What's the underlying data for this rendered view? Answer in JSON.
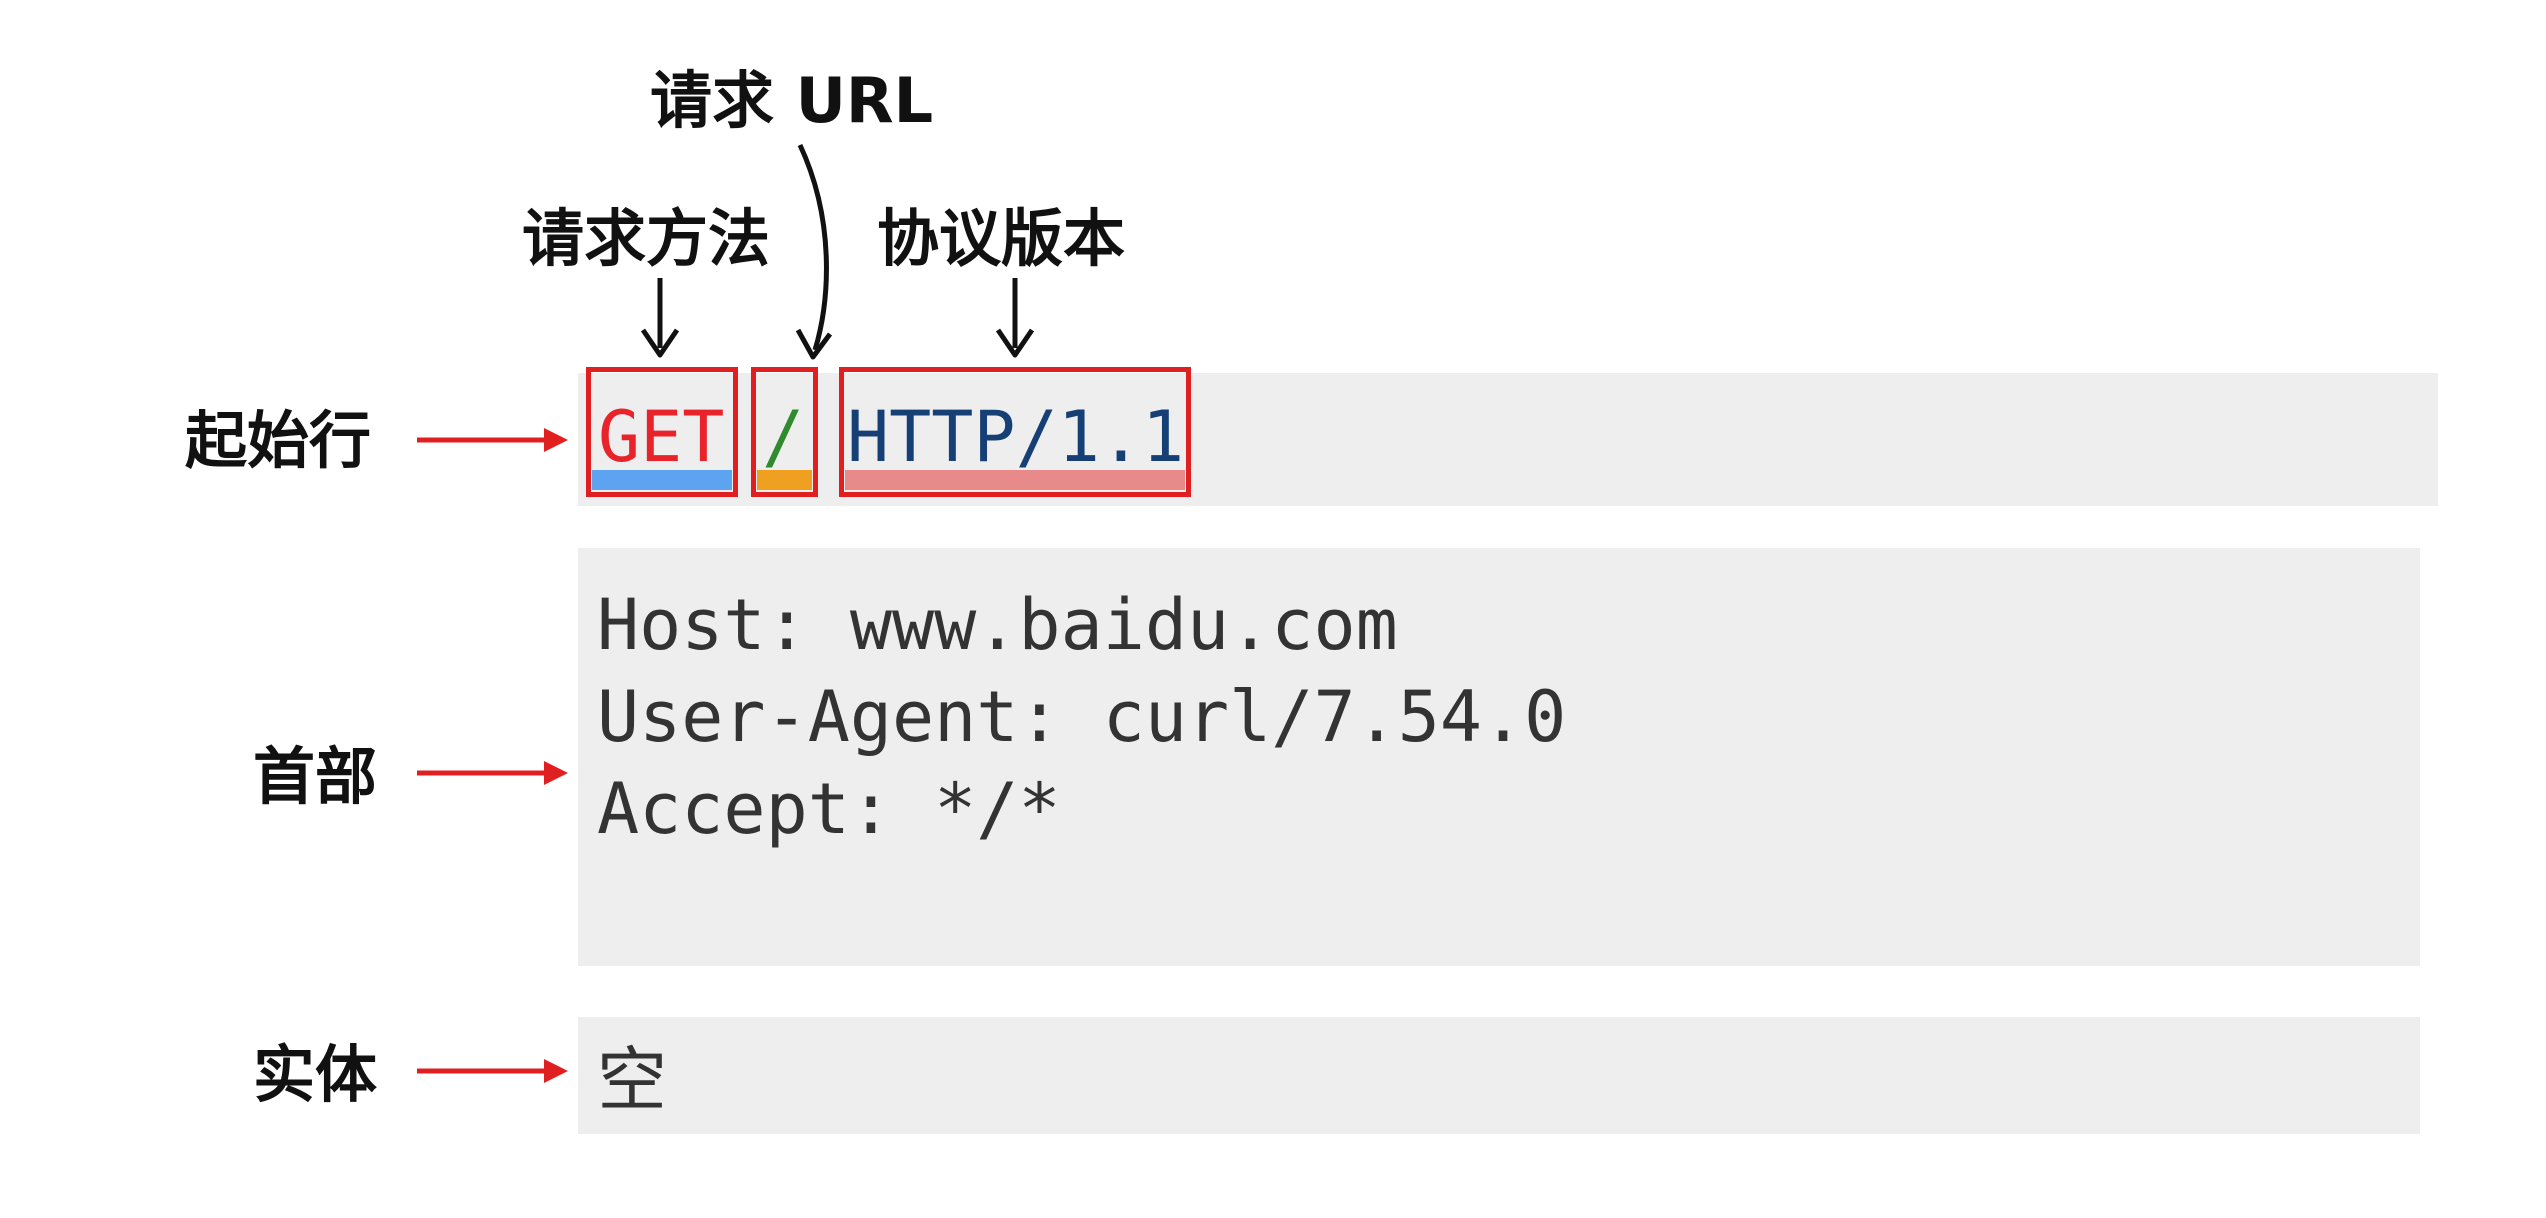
{
  "annotations": {
    "url": "请求 URL",
    "method": "请求方法",
    "version": "协议版本"
  },
  "sections": {
    "start_line": "起始行",
    "headers": "首部",
    "body": "实体"
  },
  "request_line": {
    "method": "GET",
    "url": "/",
    "version": "HTTP/1.1"
  },
  "headers": [
    "Host: www.baidu.com",
    "User-Agent: curl/7.54.0",
    "Accept: */*"
  ],
  "body": "空",
  "colors": {
    "method": "#e8232a",
    "url": "#2e8b2e",
    "version": "#163f75",
    "box_border": "#e02020",
    "method_underline": "#5ea3f0",
    "url_underline": "#f0a020",
    "version_underline": "#e88a8a",
    "block_background": "#eeeeef",
    "side_arrow": "#e02020",
    "top_arrow": "#111111"
  },
  "icons": {
    "side_arrows": "red-right-arrow-icon",
    "top_arrows": "black-down-arrow-icon"
  }
}
